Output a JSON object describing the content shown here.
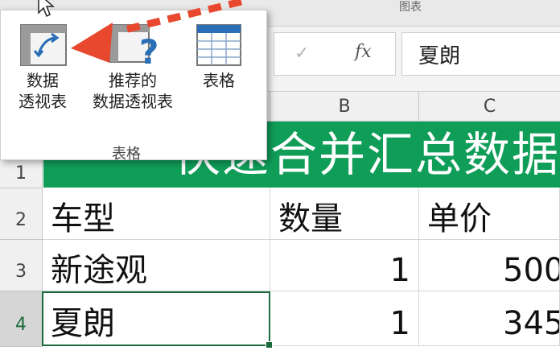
{
  "titlebar": {
    "title": "图表"
  },
  "ribbon": {
    "pivot_line1": "数据",
    "pivot_line2": "透视表",
    "recommended_line1": "推荐的",
    "recommended_line2": "数据透视表",
    "table_label": "表格",
    "group_label": "表格"
  },
  "formula_bar": {
    "fx": "fx",
    "value": "夏朗"
  },
  "columns": [
    "B",
    "C"
  ],
  "rows": [
    "1",
    "2",
    "3",
    "4"
  ],
  "sheet": {
    "title": "快速合并汇总数据",
    "headers": {
      "a": "车型",
      "b": "数量",
      "c": "单价"
    },
    "row3": {
      "a": "新途观",
      "b": "1",
      "c": "500"
    },
    "row4": {
      "a": "夏朗",
      "b": "1",
      "c": "345"
    }
  },
  "colors": {
    "banner": "#0f9d58",
    "selection": "#1d6b3c",
    "arrow": "#e8482d"
  }
}
